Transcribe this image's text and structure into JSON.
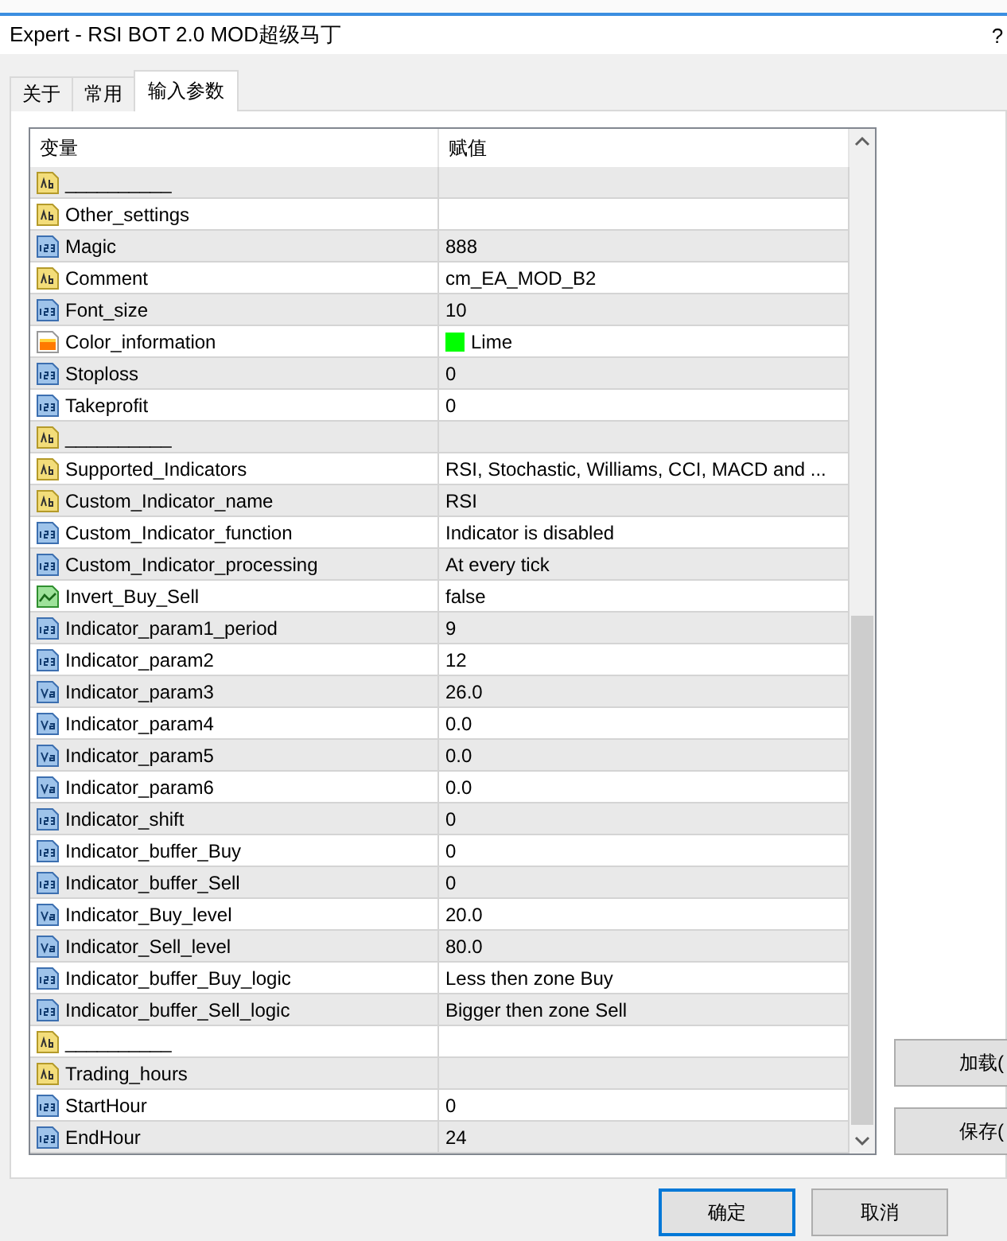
{
  "window": {
    "title": "Expert - RSI BOT 2.0 MOD超级马丁",
    "help": "?"
  },
  "tabs": [
    {
      "label": "关于",
      "selected": false
    },
    {
      "label": "常用",
      "selected": false
    },
    {
      "label": "输入参数",
      "selected": true
    }
  ],
  "table": {
    "columns": [
      "变量",
      "赋值"
    ],
    "rows": [
      {
        "kind": "string",
        "name": "__________",
        "value": ""
      },
      {
        "kind": "string",
        "name": "Other_settings",
        "value": ""
      },
      {
        "kind": "int",
        "name": "Magic",
        "value": "888"
      },
      {
        "kind": "string",
        "name": "Comment",
        "value": "cm_EA_MOD_B2"
      },
      {
        "kind": "int",
        "name": "Font_size",
        "value": "10"
      },
      {
        "kind": "color",
        "name": "Color_information",
        "value": "Lime",
        "color": "#00ff00"
      },
      {
        "kind": "int",
        "name": "Stoploss",
        "value": "0"
      },
      {
        "kind": "int",
        "name": "Takeprofit",
        "value": "0"
      },
      {
        "kind": "string",
        "name": "__________",
        "value": ""
      },
      {
        "kind": "string",
        "name": "Supported_Indicators",
        "value": "RSI, Stochastic, Williams, CCI, MACD and ..."
      },
      {
        "kind": "string",
        "name": "Custom_Indicator_name",
        "value": "RSI"
      },
      {
        "kind": "int",
        "name": "Custom_Indicator_function",
        "value": "Indicator is disabled"
      },
      {
        "kind": "int",
        "name": "Custom_Indicator_processing",
        "value": "At every tick"
      },
      {
        "kind": "bool",
        "name": "Invert_Buy_Sell",
        "value": "false"
      },
      {
        "kind": "int",
        "name": "Indicator_param1_period",
        "value": "9"
      },
      {
        "kind": "int",
        "name": "Indicator_param2",
        "value": "12"
      },
      {
        "kind": "double",
        "name": "Indicator_param3",
        "value": "26.0"
      },
      {
        "kind": "double",
        "name": "Indicator_param4",
        "value": "0.0"
      },
      {
        "kind": "double",
        "name": "Indicator_param5",
        "value": "0.0"
      },
      {
        "kind": "double",
        "name": "Indicator_param6",
        "value": "0.0"
      },
      {
        "kind": "int",
        "name": "Indicator_shift",
        "value": "0"
      },
      {
        "kind": "int",
        "name": "Indicator_buffer_Buy",
        "value": "0"
      },
      {
        "kind": "int",
        "name": "Indicator_buffer_Sell",
        "value": "0"
      },
      {
        "kind": "double",
        "name": "Indicator_Buy_level",
        "value": "20.0"
      },
      {
        "kind": "double",
        "name": "Indicator_Sell_level",
        "value": "80.0"
      },
      {
        "kind": "int",
        "name": "Indicator_buffer_Buy_logic",
        "value": "Less then zone Buy"
      },
      {
        "kind": "int",
        "name": "Indicator_buffer_Sell_logic",
        "value": "Bigger then zone Sell"
      },
      {
        "kind": "string",
        "name": "__________",
        "value": ""
      },
      {
        "kind": "string",
        "name": "Trading_hours",
        "value": ""
      },
      {
        "kind": "int",
        "name": "StartHour",
        "value": "0"
      },
      {
        "kind": "int",
        "name": "EndHour",
        "value": "24"
      }
    ]
  },
  "side_buttons": [
    "加载(",
    "保存("
  ],
  "bottom_buttons": [
    "确定",
    "取消"
  ]
}
